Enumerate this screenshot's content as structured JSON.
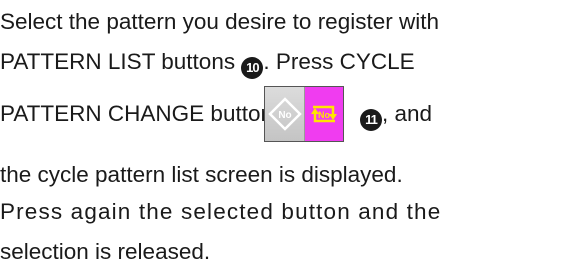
{
  "document": {
    "line1": "Select the pattern you desire to register with",
    "line2_text": "PATTERN LIST buttons ",
    "line2_num": "10",
    "line2_after": ". Press CYCLE",
    "line3_text": "PATTERN CHANGE button",
    "line3_num": "11",
    "line3_after": ", and",
    "line4": "the cycle pattern list screen is displayed.",
    "line5": "Press again the selected button and the",
    "line6": "selection is released.",
    "button_left_glyph": "No",
    "button_right_glyph": "No"
  },
  "colors": {
    "button_right_bg": "#f03cf0",
    "button_right_icon": "#ffe600",
    "button_left_bg": "#d0d0d0"
  },
  "icons": {
    "cycle_button": "cycle-pattern-change-icon"
  }
}
